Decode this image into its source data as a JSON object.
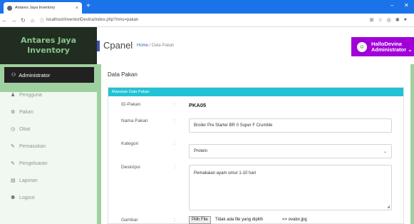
{
  "browser": {
    "tab_title": "Antares Jaya Inventory",
    "tab_close": "×",
    "new_tab": "+",
    "minimize": "–",
    "close": "✕",
    "url": "localhost/inventoriDevina/index.php?mnu=pakan"
  },
  "sidebar": {
    "brand_line1": "Antares Jaya",
    "brand_line2": "Inventory",
    "role": "Administrator",
    "items": [
      {
        "label": "Pengguna",
        "icon": "user-icon"
      },
      {
        "label": "Pakan",
        "icon": "gear-icon"
      },
      {
        "label": "Obat",
        "icon": "clock-icon"
      },
      {
        "label": "Pemasukan",
        "icon": "pencil-icon"
      },
      {
        "label": "Pengeluaran",
        "icon": "pencil-icon"
      },
      {
        "label": "Laporan",
        "icon": "report-icon"
      },
      {
        "label": "Logout",
        "icon": "users-icon"
      }
    ]
  },
  "header": {
    "title": "Cpanel",
    "breadcrumb_home": "Home",
    "breadcrumb_sep": " / ",
    "breadcrumb_current": "Data Pakan",
    "user_greeting": "HalloDevina",
    "user_role": "Administrator"
  },
  "main": {
    "page_title": "Data Pakan",
    "card_title": "Masukan Data Pakan",
    "fields": {
      "id_label": "ID-Pakan",
      "id_value": "PKA05",
      "nama_label": "Nama Pakan",
      "nama_value": "Broiler Pre Starter BR 0 Super F Crumble",
      "kategori_label": "Kategori",
      "kategori_value": "Protein",
      "deskripsi_label": "Deskripsi",
      "deskripsi_value": "Pemakaian ayam umur 1-10 hari",
      "gambar_label": "Gambar",
      "file_button": "Pilih File",
      "file_none": "Tidak ada file yang dipilih",
      "file_current": "=> ovator.jpg",
      "colon": ":"
    }
  },
  "colors": {
    "tabbar": "#1a73e8",
    "brand_bg": "#202d20",
    "accent_green": "#9fd09f",
    "card_header": "#21c2d4",
    "user_box": "#a100d8"
  }
}
